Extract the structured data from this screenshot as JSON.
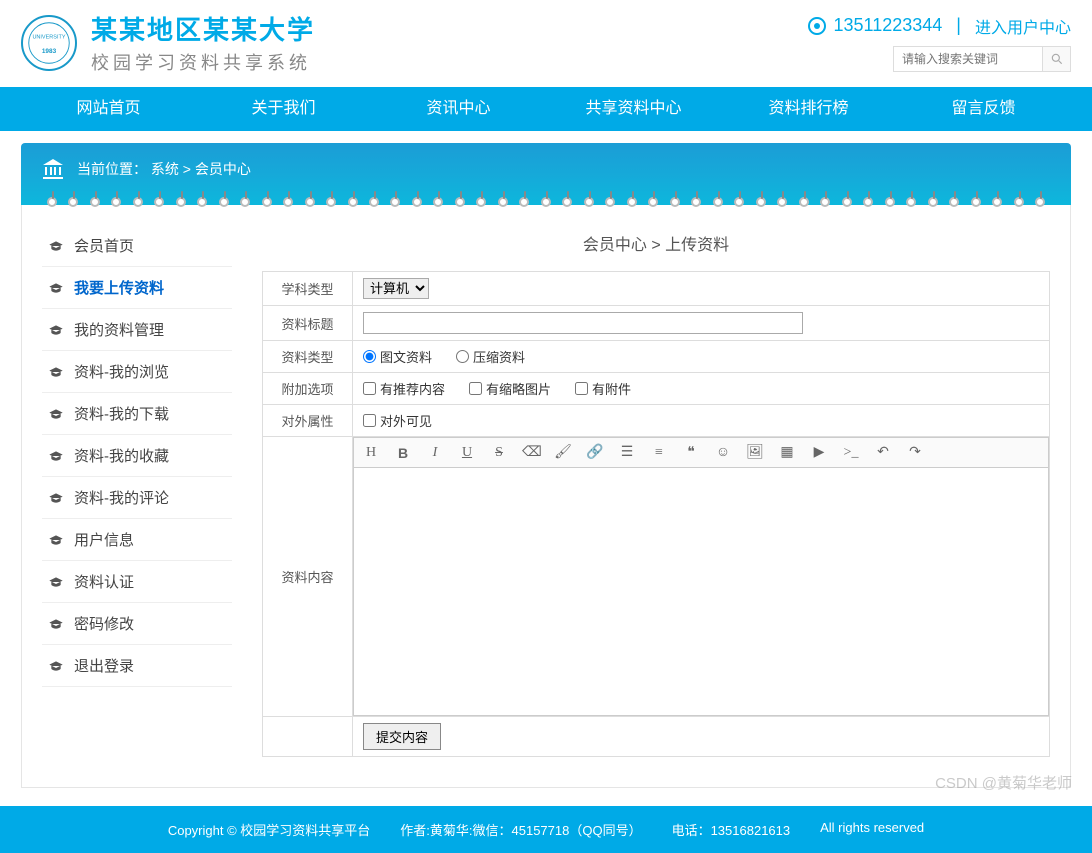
{
  "header": {
    "title": "某某地区某某大学",
    "subtitle": "校园学习资料共享系统",
    "phone": "13511223344",
    "user_center": "进入用户中心",
    "search_placeholder": "请输入搜索关键词"
  },
  "nav": {
    "items": [
      "网站首页",
      "关于我们",
      "资讯中心",
      "共享资料中心",
      "资料排行榜",
      "留言反馈"
    ]
  },
  "breadcrumb": {
    "label": "当前位置：",
    "part1": "系统",
    "sep": ">",
    "part2": "会员中心"
  },
  "sidebar": {
    "items": [
      {
        "label": "会员首页",
        "active": false
      },
      {
        "label": "我要上传资料",
        "active": true
      },
      {
        "label": "我的资料管理",
        "active": false
      },
      {
        "label": "资料-我的浏览",
        "active": false
      },
      {
        "label": "资料-我的下载",
        "active": false
      },
      {
        "label": "资料-我的收藏",
        "active": false
      },
      {
        "label": "资料-我的评论",
        "active": false
      },
      {
        "label": "用户信息",
        "active": false
      },
      {
        "label": "资料认证",
        "active": false
      },
      {
        "label": "密码修改",
        "active": false
      },
      {
        "label": "退出登录",
        "active": false
      }
    ]
  },
  "content": {
    "title": "会员中心 > 上传资料",
    "form": {
      "subject_label": "学科类型",
      "subject_value": "计算机",
      "title_label": "资料标题",
      "type_label": "资料类型",
      "type_opt1": "图文资料",
      "type_opt2": "压缩资料",
      "addon_label": "附加选项",
      "addon_opt1": "有推荐内容",
      "addon_opt2": "有缩略图片",
      "addon_opt3": "有附件",
      "external_label": "对外属性",
      "external_opt": "对外可见",
      "content_label": "资料内容",
      "submit": "提交内容"
    }
  },
  "footer": {
    "copyright": "Copyright © 校园学习资料共享平台",
    "author": "作者:黄菊华:微信：45157718（QQ同号）",
    "phone": "电话：13516821613",
    "rights": "All rights reserved"
  },
  "watermark": "CSDN @黄菊华老师"
}
